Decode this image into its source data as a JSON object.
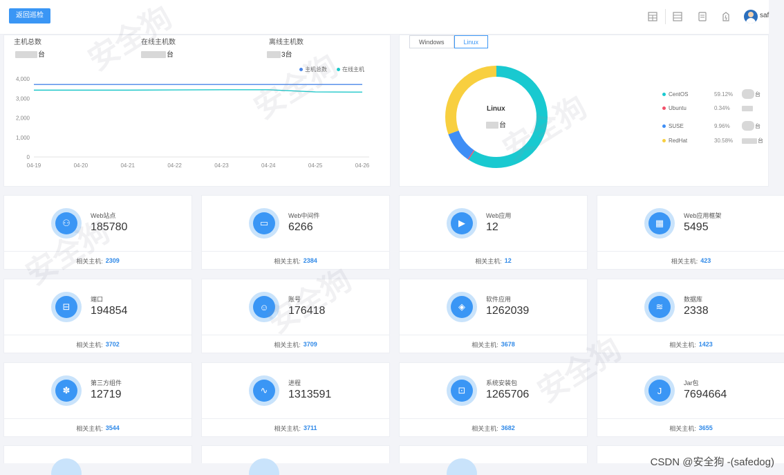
{
  "header": {
    "back_label": "返回巡检",
    "user_name": "saf",
    "icons": [
      "grid-icon",
      "server-icon",
      "report-icon",
      "alert-icon"
    ]
  },
  "host_stats": {
    "total_label": "主机总数",
    "online_label": "在线主机数",
    "offline_label": "离线主机数",
    "total_value": "台",
    "online_value": "台",
    "offline_value": "3台"
  },
  "os_tabs": [
    "Windows",
    "Linux"
  ],
  "os_active_tab": "Linux",
  "chart_data": [
    {
      "type": "line",
      "x": [
        "04-19",
        "04-20",
        "04-21",
        "04-22",
        "04-23",
        "04-24",
        "04-25",
        "04-26"
      ],
      "series": [
        {
          "name": "主机总数",
          "color": "#4a86e8",
          "values": [
            3710,
            3710,
            3710,
            3710,
            3710,
            3710,
            3710,
            3710
          ]
        },
        {
          "name": "在线主机",
          "color": "#1dc7c9",
          "values": [
            3420,
            3420,
            3420,
            3430,
            3440,
            3440,
            3330,
            3320
          ]
        }
      ],
      "yticks": [
        "0",
        "1,000",
        "2,000",
        "3,000",
        "4,000"
      ],
      "ylim": [
        0,
        4000
      ],
      "legend_position": "top-right",
      "grid": false
    },
    {
      "type": "pie",
      "center_label": "Linux",
      "center_value": "台",
      "slices": [
        {
          "name": "CentOS",
          "percent": "59.12%",
          "value": 59.12,
          "color": "#19c9d0",
          "count": "台"
        },
        {
          "name": "Ubuntu",
          "percent": "0.34%",
          "value": 0.34,
          "color": "#f2516a",
          "count": ""
        },
        {
          "name": "SUSE",
          "percent": "9.96%",
          "value": 9.96,
          "color": "#3f8ef5",
          "count": "台"
        },
        {
          "name": "RedHat",
          "percent": "30.58%",
          "value": 30.58,
          "color": "#f8cf3f",
          "count": "台"
        }
      ]
    }
  ],
  "related_label": "相关主机:",
  "cards": [
    {
      "title": "Web站点",
      "value": "185780",
      "related": "2309",
      "icon": "sitemap-icon",
      "glyph": "⚇"
    },
    {
      "title": "Web中间件",
      "value": "6266",
      "related": "2384",
      "icon": "monitor-icon",
      "glyph": "▭"
    },
    {
      "title": "Web应用",
      "value": "12",
      "related": "12",
      "icon": "play-icon",
      "glyph": "▶"
    },
    {
      "title": "Web应用框架",
      "value": "5495",
      "related": "423",
      "icon": "frame-icon",
      "glyph": "▦"
    },
    {
      "title": "端口",
      "value": "194854",
      "related": "3702",
      "icon": "port-icon",
      "glyph": "⊟"
    },
    {
      "title": "账号",
      "value": "176418",
      "related": "3709",
      "icon": "user-icon",
      "glyph": "☺"
    },
    {
      "title": "软件应用",
      "value": "1262039",
      "related": "3678",
      "icon": "cube-icon",
      "glyph": "◈"
    },
    {
      "title": "数据库",
      "value": "2338",
      "related": "1423",
      "icon": "database-icon",
      "glyph": "≋"
    },
    {
      "title": "第三方组件",
      "value": "12719",
      "related": "3544",
      "icon": "puzzle-icon",
      "glyph": "✽"
    },
    {
      "title": "进程",
      "value": "1313591",
      "related": "3711",
      "icon": "pulse-icon",
      "glyph": "∿"
    },
    {
      "title": "系统安装包",
      "value": "1265706",
      "related": "3682",
      "icon": "package-icon",
      "glyph": "⊡"
    },
    {
      "title": "Jar包",
      "value": "7694664",
      "related": "3655",
      "icon": "jar-icon",
      "glyph": "J"
    }
  ],
  "credit": "CSDN @安全狗 -(safedog)"
}
